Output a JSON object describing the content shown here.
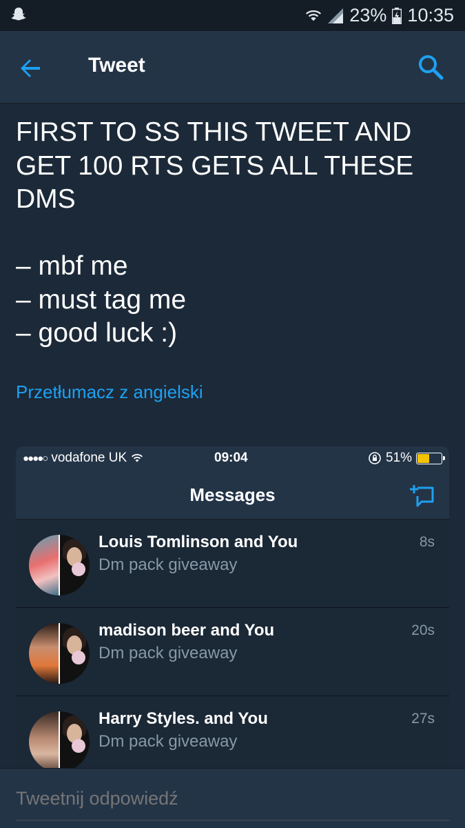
{
  "status_bar": {
    "battery": "23%",
    "time": "10:35",
    "icons": [
      "snapchat-ghost-icon",
      "wifi-icon",
      "signal-icon",
      "battery-charging-icon"
    ]
  },
  "header": {
    "title": "Tweet",
    "back_icon": "arrow-left-icon",
    "search_icon": "search-icon",
    "accent": "#1da1f2"
  },
  "tweet": {
    "text": "FIRST TO SS THIS TWEET AND GET 100 RTS GETS ALL THESE DMS\n\n– mbf me\n– must tag me\n– good luck :)",
    "translate_link": "Przetłumacz z angielski"
  },
  "media": {
    "ios_status": {
      "carrier": "vodafone UK",
      "time": "09:04",
      "battery": "51%",
      "battery_level": 0.51
    },
    "title": "Messages",
    "compose_icon": "new-message-icon",
    "conversations": [
      {
        "name": "Louis Tomlinson and You",
        "snippet": "Dm pack giveaway",
        "time": "8s"
      },
      {
        "name": "madison beer and You",
        "snippet": "Dm pack giveaway",
        "time": "20s"
      },
      {
        "name": "Harry Styles. and You",
        "snippet": "Dm pack giveaway",
        "time": "27s"
      }
    ]
  },
  "reply": {
    "placeholder": "Tweetnij odpowiedź"
  },
  "colors": {
    "background": "#1c2938",
    "header": "#243447",
    "link": "#1da1f2",
    "muted": "#8899a6"
  }
}
